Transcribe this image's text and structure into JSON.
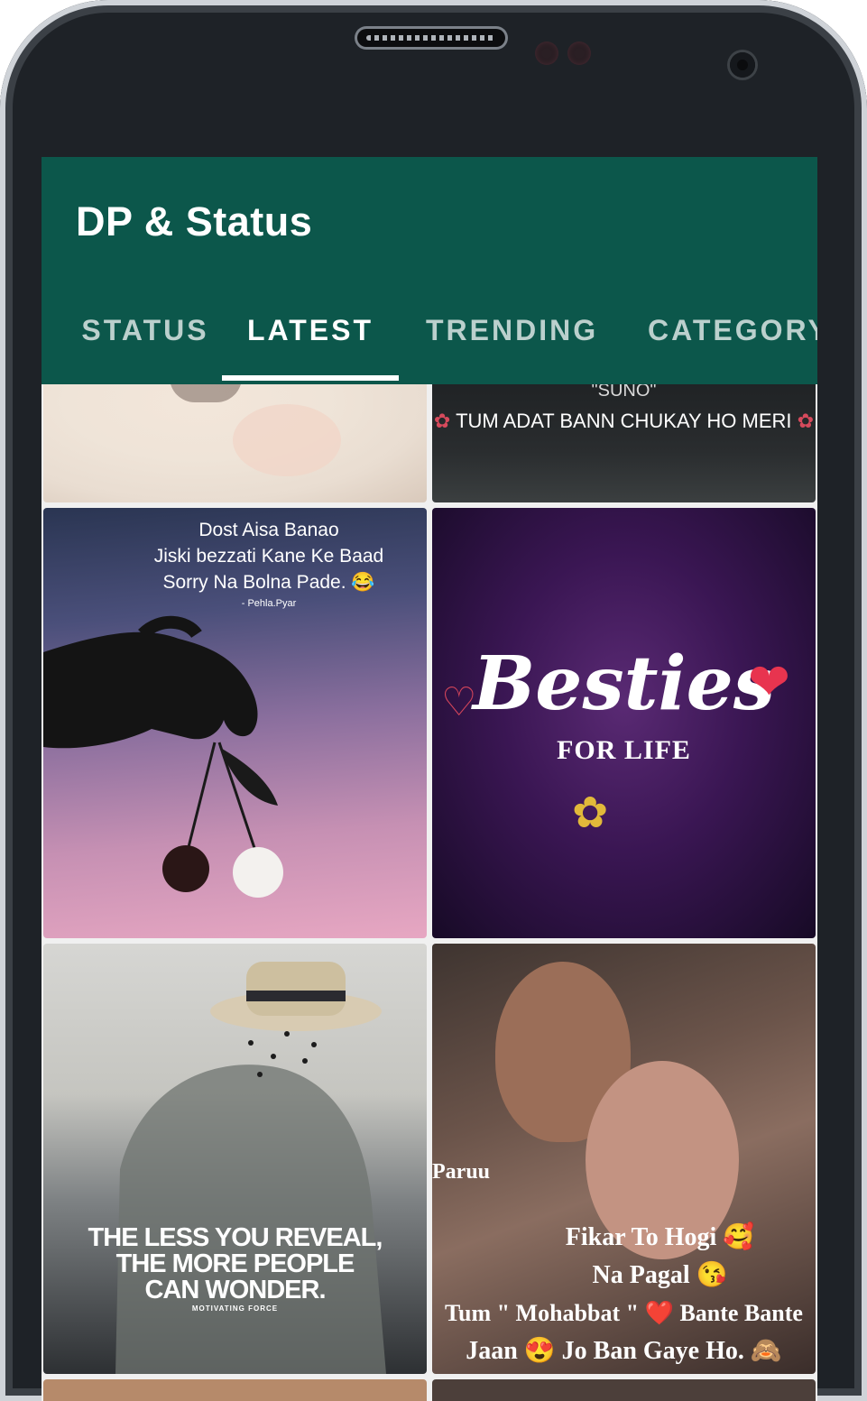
{
  "app": {
    "title": "DP & Status",
    "theme_color": "#0c574b"
  },
  "tabs": [
    {
      "label": "STATUS",
      "active": false
    },
    {
      "label": "LATEST",
      "active": true
    },
    {
      "label": "TRENDING",
      "active": false
    },
    {
      "label": "CATEGORY",
      "active": false
    }
  ],
  "grid": {
    "items": [
      {
        "kind": "photo",
        "text_lines": []
      },
      {
        "kind": "quote",
        "text_lines": [
          "\"SUNO\"",
          "TUM ADAT BANN CHUKAY HO MERI"
        ]
      },
      {
        "kind": "quote",
        "text_lines": [
          "Dost Aisa Banao",
          "Jiski bezzati Kane Ke Baad",
          "Sorry Na Bolna Pade. 😂",
          "- Pehla.Pyar"
        ]
      },
      {
        "kind": "quote",
        "text_lines": [
          "Besties",
          "FOR LIFE"
        ]
      },
      {
        "kind": "quote",
        "text_lines": [
          "THE LESS YOU REVEAL,",
          "THE MORE PEOPLE",
          "CAN WONDER.",
          "MOTIVATING FORCE"
        ]
      },
      {
        "kind": "quote",
        "text_lines": [
          "Paruu",
          "Fikar To Hogi 🥰",
          "Na Pagal 😘",
          "Tum \" Mohabbat \" ❤️ Bante Bante",
          "Jaan 😍 Jo Ban Gaye Ho. 🙈"
        ]
      }
    ]
  }
}
